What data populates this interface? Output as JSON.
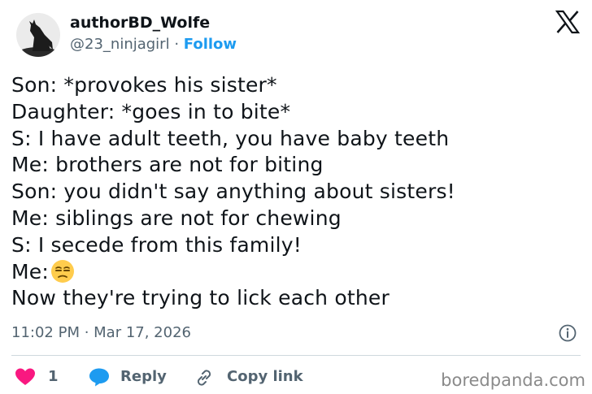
{
  "tweet": {
    "author_name": "authorBD_Wolfe",
    "handle": "@23_ninjagirl",
    "separator": " · ",
    "follow_label": "Follow",
    "lines": [
      "Son: *provokes his sister*",
      "Daughter: *goes in to bite*",
      "S: I have adult teeth, you have baby teeth",
      "Me: brothers are not for biting",
      "Son: you didn't say anything about sisters!",
      "Me: siblings are not for chewing",
      "S: I secede from this family!",
      "Me:",
      "Now they're trying to lick each other"
    ],
    "emoji_icon": "unamused-face-icon",
    "timestamp": "11:02 PM · Mar 17, 2026"
  },
  "actions": {
    "like_count": "1",
    "reply_label": "Reply",
    "copy_label": "Copy link"
  },
  "watermark": "boredpanda.com",
  "colors": {
    "text": "#0f1419",
    "secondary": "#536471",
    "accent": "#1d9bf0",
    "like": "#f91880",
    "divider": "#cfd9de"
  },
  "icons": [
    "wolf-avatar",
    "x-logo-icon",
    "info-icon",
    "heart-icon",
    "speech-bubble-icon",
    "link-icon"
  ]
}
